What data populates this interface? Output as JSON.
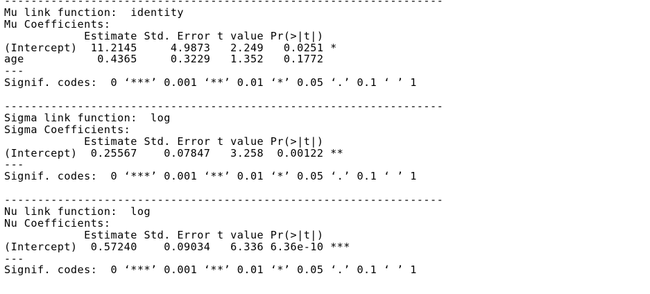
{
  "output_lines": [
    "------------------------------------------------------------------",
    "Mu link function:  identity",
    "Mu Coefficients:",
    "            Estimate Std. Error t value Pr(>|t|)  ",
    "(Intercept)  11.2145     4.9873   2.249   0.0251 *",
    "age           0.4365     0.3229   1.352   0.1772  ",
    "---",
    "Signif. codes:  0 ‘***’ 0.001 ‘**’ 0.01 ‘*’ 0.05 ‘.’ 0.1 ‘ ’ 1",
    "",
    "------------------------------------------------------------------",
    "Sigma link function:  log",
    "Sigma Coefficients:",
    "            Estimate Std. Error t value Pr(>|t|)   ",
    "(Intercept)  0.25567    0.07847   3.258  0.00122 **",
    "---",
    "Signif. codes:  0 ‘***’ 0.001 ‘**’ 0.01 ‘*’ 0.05 ‘.’ 0.1 ‘ ’ 1",
    "",
    "------------------------------------------------------------------",
    "Nu link function:  log ",
    "Nu Coefficients:",
    "            Estimate Std. Error t value Pr(>|t|)    ",
    "(Intercept)  0.57240    0.09034   6.336 6.36e-10 ***",
    "---",
    "Signif. codes:  0 ‘***’ 0.001 ‘**’ 0.01 ‘*’ 0.05 ‘.’ 0.1 ‘ ’ 1"
  ]
}
